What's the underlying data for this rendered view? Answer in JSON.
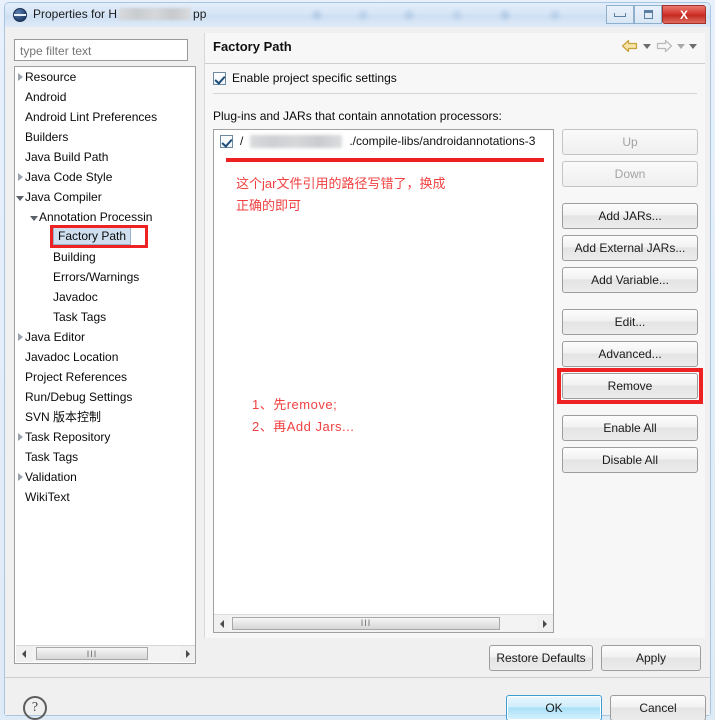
{
  "window": {
    "title_prefix": "Properties for H",
    "title_suffix": "pp",
    "icon": "eclipse-icon",
    "controls": {
      "minimize": "Minimize",
      "maximize": "Restore",
      "close": "X"
    }
  },
  "sidebar": {
    "filter_placeholder": "type filter text",
    "filter_value": "",
    "items": [
      {
        "label": "Resource",
        "indent": 0,
        "twisty": "collapsed",
        "selected": false
      },
      {
        "label": "Android",
        "indent": 0,
        "twisty": "none",
        "selected": false
      },
      {
        "label": "Android Lint Preferences",
        "indent": 0,
        "twisty": "none",
        "selected": false
      },
      {
        "label": "Builders",
        "indent": 0,
        "twisty": "none",
        "selected": false
      },
      {
        "label": "Java Build Path",
        "indent": 0,
        "twisty": "none",
        "selected": false
      },
      {
        "label": "Java Code Style",
        "indent": 0,
        "twisty": "collapsed",
        "selected": false
      },
      {
        "label": "Java Compiler",
        "indent": 0,
        "twisty": "expanded",
        "selected": false
      },
      {
        "label": "Annotation Processin",
        "indent": 1,
        "twisty": "expanded",
        "selected": false
      },
      {
        "label": "Factory Path",
        "indent": 2,
        "twisty": "none",
        "selected": true
      },
      {
        "label": "Building",
        "indent": 2,
        "twisty": "none",
        "selected": false
      },
      {
        "label": "Errors/Warnings",
        "indent": 2,
        "twisty": "none",
        "selected": false
      },
      {
        "label": "Javadoc",
        "indent": 2,
        "twisty": "none",
        "selected": false
      },
      {
        "label": "Task Tags",
        "indent": 2,
        "twisty": "none",
        "selected": false
      },
      {
        "label": "Java Editor",
        "indent": 0,
        "twisty": "collapsed",
        "selected": false
      },
      {
        "label": "Javadoc Location",
        "indent": 0,
        "twisty": "none",
        "selected": false
      },
      {
        "label": "Project References",
        "indent": 0,
        "twisty": "none",
        "selected": false
      },
      {
        "label": "Run/Debug Settings",
        "indent": 0,
        "twisty": "none",
        "selected": false
      },
      {
        "label": "SVN 版本控制",
        "indent": 0,
        "twisty": "none",
        "selected": false
      },
      {
        "label": "Task Repository",
        "indent": 0,
        "twisty": "collapsed",
        "selected": false
      },
      {
        "label": "Task Tags",
        "indent": 0,
        "twisty": "none",
        "selected": false
      },
      {
        "label": "Validation",
        "indent": 0,
        "twisty": "collapsed",
        "selected": false
      },
      {
        "label": "WikiText",
        "indent": 0,
        "twisty": "none",
        "selected": false
      }
    ],
    "scroll_thumb_grip": "III"
  },
  "main": {
    "title": "Factory Path",
    "nav": {
      "back": "back-arrow",
      "back_menu": "back-dropdown",
      "forward": "forward-arrow",
      "forward_menu": "forward-dropdown",
      "view_menu": "view-menu"
    },
    "enable_checkbox": {
      "label": "Enable project specific settings",
      "checked": true
    },
    "list_label": "Plug-ins and JARs that contain annotation processors:",
    "list_rows": [
      {
        "checked": true,
        "prefix": "/",
        "redacted": true,
        "suffix": "./compile-libs/androidannotations-3"
      }
    ],
    "list_scroll_grip": "III",
    "buttons": [
      {
        "label": "Up",
        "disabled": true,
        "highlight": false,
        "gap": "none"
      },
      {
        "label": "Down",
        "disabled": true,
        "highlight": false,
        "gap": "lg"
      },
      {
        "label": "Add JARs...",
        "disabled": false,
        "highlight": false,
        "gap": "none"
      },
      {
        "label": "Add External JARs...",
        "disabled": false,
        "highlight": false,
        "gap": "none"
      },
      {
        "label": "Add Variable...",
        "disabled": false,
        "highlight": false,
        "gap": "lg"
      },
      {
        "label": "Edit...",
        "disabled": false,
        "highlight": false,
        "gap": "none"
      },
      {
        "label": "Advanced...",
        "disabled": false,
        "highlight": false,
        "gap": "none"
      },
      {
        "label": "Remove",
        "disabled": false,
        "highlight": true,
        "gap": "lg"
      },
      {
        "label": "Enable All",
        "disabled": false,
        "highlight": false,
        "gap": "none"
      },
      {
        "label": "Disable All",
        "disabled": false,
        "highlight": false,
        "gap": "none"
      }
    ],
    "restore_defaults_label": "Restore Defaults",
    "apply_label": "Apply"
  },
  "annotations": {
    "color": "#f04040",
    "note_1_line_1": "这个jar文件引用的路径写错了，换成",
    "note_1_line_2": "正确的即可",
    "note_2_line_1": "1、先remove;",
    "note_2_line_2": "2、再Add Jars..."
  },
  "footer": {
    "help_icon": "?",
    "ok_label": "OK",
    "cancel_label": "Cancel"
  }
}
